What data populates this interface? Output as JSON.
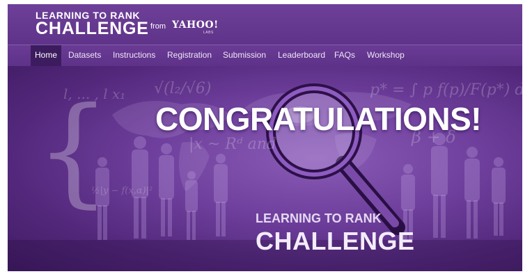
{
  "brand": {
    "title_line1": "LEARNING TO RANK",
    "title_line2": "CHALLENGE",
    "from_label": "from",
    "sponsor_name": "YAHOO!",
    "sponsor_sub": "LABS"
  },
  "nav": {
    "active": "Home",
    "items": [
      {
        "label": "Home"
      },
      {
        "label": "Datasets"
      },
      {
        "label": "Instructions"
      },
      {
        "label": "Registration"
      },
      {
        "label": "Submission"
      },
      {
        "label": "Leaderboard"
      },
      {
        "label": "FAQs"
      },
      {
        "label": "Workshop"
      }
    ]
  },
  "hero": {
    "headline": "CONGRATULATIONS!",
    "subtitle_line1": "LEARNING TO RANK",
    "subtitle_line2": "CHALLENGE",
    "icons": [
      "magnifying-glass-icon",
      "crowd-silhouette-icon",
      "world-map-icon"
    ]
  },
  "colors": {
    "header_bg": "#5f3389",
    "nav_active_bg": "#3c1c5e",
    "banner_bg": "#6e3f9c",
    "text": "#ffffff"
  }
}
